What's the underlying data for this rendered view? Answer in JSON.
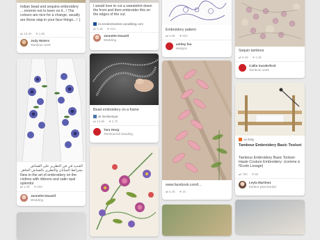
{
  "pins": [
    {
      "desc": "Indian bead and sequins embroidery ....mmmm not to keen on it...! The colours are nice for a change, usually are those slap in your face things...! :)",
      "meta": {
        "repins": "16.2k",
        "likes": "1.6k"
      },
      "owner": {
        "name": "Judy Waters",
        "board": "Tambour work"
      }
    },
    {
      "desc": "I would love to cut a sweatshirt down the front and then embroider this on the edges of the cut.",
      "source": "ex.tendenteartes.canalblog.com",
      "meta": {
        "repins": "4.3k",
        "likes": "443"
      },
      "owner": {
        "name": "Jannette Deazell",
        "board": "Wedding"
      }
    },
    {
      "desc": "Embroidery pattern",
      "meta": {
        "repins": "5.9k",
        "likes": "502"
      },
      "owner": {
        "name": "ashley foa",
        "board": "designs"
      }
    },
    {
      "desc": "Sequin tambour",
      "meta": {
        "repins": "9.4k",
        "likes": "1.3k"
      },
      "owner": {
        "name": "Callie Sunderford",
        "board": "Tambour work"
      }
    },
    {
      "desc_ar": "الجديد في فن التطريز على القماش بشرائط الساتان والتطريز بالقماش الجاهز",
      "desc": "New in the art of embroidery on the clothes with ribbons and satin opal splendor",
      "meta": {
        "repins": "1.9k",
        "likes": "299"
      },
      "owner": {
        "name": "Jannette Deazell",
        "board": "Wedding"
      }
    },
    {
      "desc": "Bead embroidery on a frame",
      "source": "vk  livelinespar",
      "meta": {
        "repins": "13.8k",
        "likes": "2.7k"
      },
      "owner": {
        "name": "Tara Hoop",
        "board": "Tambour/ari beading"
      }
    },
    {
      "desc": "www.facebook.com/l...",
      "meta": {
        "repins": "5.3k",
        "likes": "1k"
      }
    },
    {
      "badge": "on Etsy",
      "title": "Tambour Embroidery Basic Toolset",
      "desc": "Tambour Embroidery Basic Toolset-Haute Couture Embroidery- (comme à l'Ecole Lesage)",
      "meta": {
        "repins": "780",
        "likes": "96"
      },
      "owner": {
        "name": "Leyla Martinez",
        "board": "tambor para bordar"
      }
    }
  ],
  "colors": {
    "background": "#e9e9e9",
    "card": "#ffffff",
    "pinterest_red": "#cb2027",
    "etsy_orange": "#f1641e"
  },
  "icons": [
    "repin-icon",
    "heart-icon",
    "source-icon",
    "avatar"
  ]
}
